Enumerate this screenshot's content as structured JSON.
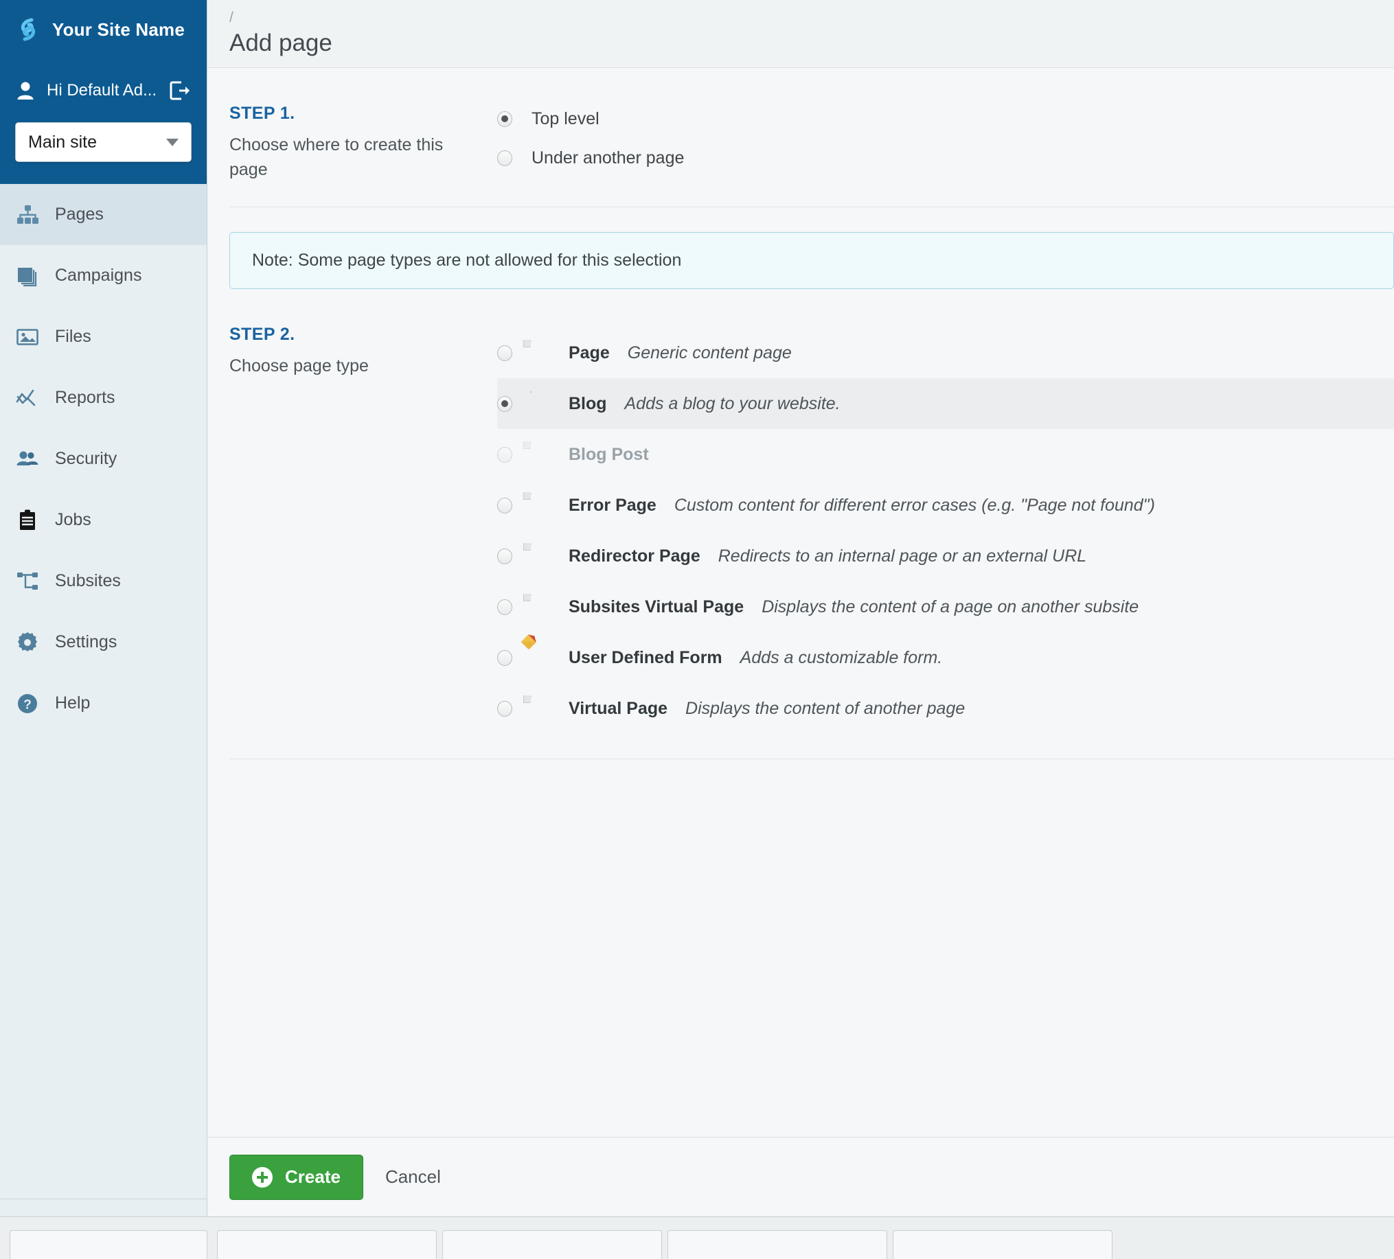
{
  "sidebar": {
    "brand": {
      "title": "Your Site Name",
      "logo_icon": "logo-icon"
    },
    "user": {
      "greeting": "Hi Default Ad...",
      "avatar_icon": "user-icon",
      "logout_icon": "logout-icon"
    },
    "site_select": {
      "value": "Main site",
      "caret_icon": "chevron-down-icon"
    },
    "items": [
      {
        "label": "Pages",
        "icon": "sitemap-icon",
        "active": true
      },
      {
        "label": "Campaigns",
        "icon": "stack-icon",
        "active": false
      },
      {
        "label": "Files",
        "icon": "image-icon",
        "active": false
      },
      {
        "label": "Reports",
        "icon": "chart-line-icon",
        "active": false
      },
      {
        "label": "Security",
        "icon": "users-icon",
        "active": false
      },
      {
        "label": "Jobs",
        "icon": "clipboard-icon",
        "active": false
      },
      {
        "label": "Subsites",
        "icon": "nodes-icon",
        "active": false
      },
      {
        "label": "Settings",
        "icon": "gear-icon",
        "active": false
      },
      {
        "label": "Help",
        "icon": "question-circle-icon",
        "active": false
      }
    ],
    "footer": {
      "spinner_icon": "loading-ring-icon",
      "collapse_label": "«"
    }
  },
  "header": {
    "breadcrumb": "/",
    "title": "Add page"
  },
  "step1": {
    "kicker": "STEP 1.",
    "description": "Choose where to create this page",
    "options": [
      {
        "label": "Top level",
        "checked": true
      },
      {
        "label": "Under another page",
        "checked": false
      }
    ]
  },
  "note": {
    "text": "Note: Some page types are not allowed for this selection"
  },
  "step2": {
    "kicker": "STEP 2.",
    "description": "Choose page type",
    "types": [
      {
        "name": "Page",
        "desc": "Generic content page",
        "icon": "document-icon",
        "checked": false,
        "disabled": false
      },
      {
        "name": "Blog",
        "desc": "Adds a blog to your website.",
        "icon": "blog-icon",
        "checked": true,
        "disabled": false
      },
      {
        "name": "Blog Post",
        "desc": "",
        "icon": "document-icon",
        "checked": false,
        "disabled": true
      },
      {
        "name": "Error Page",
        "desc": "Custom content for different error cases (e.g. \"Page not found\")",
        "icon": "document-icon",
        "checked": false,
        "disabled": false
      },
      {
        "name": "Redirector Page",
        "desc": "Redirects to an internal page or an external URL",
        "icon": "document-icon",
        "checked": false,
        "disabled": false
      },
      {
        "name": "Subsites Virtual Page",
        "desc": "Displays the content of a page on another subsite",
        "icon": "document-icon",
        "checked": false,
        "disabled": false
      },
      {
        "name": "User Defined Form",
        "desc": "Adds a customizable form.",
        "icon": "form-pencil-icon",
        "checked": false,
        "disabled": false
      },
      {
        "name": "Virtual Page",
        "desc": "Displays the content of another page",
        "icon": "document-icon",
        "checked": false,
        "disabled": false
      }
    ]
  },
  "actions": {
    "create_label": "Create",
    "create_icon": "plus-circle-icon",
    "cancel_label": "Cancel"
  },
  "colors": {
    "brand_blue": "#0d5a91",
    "sidebar_bg": "#e7eff2",
    "accent_blue": "#1b63a0",
    "create_green": "#3aa13e",
    "note_bg": "#effafc",
    "note_border": "#a8d5e2"
  }
}
